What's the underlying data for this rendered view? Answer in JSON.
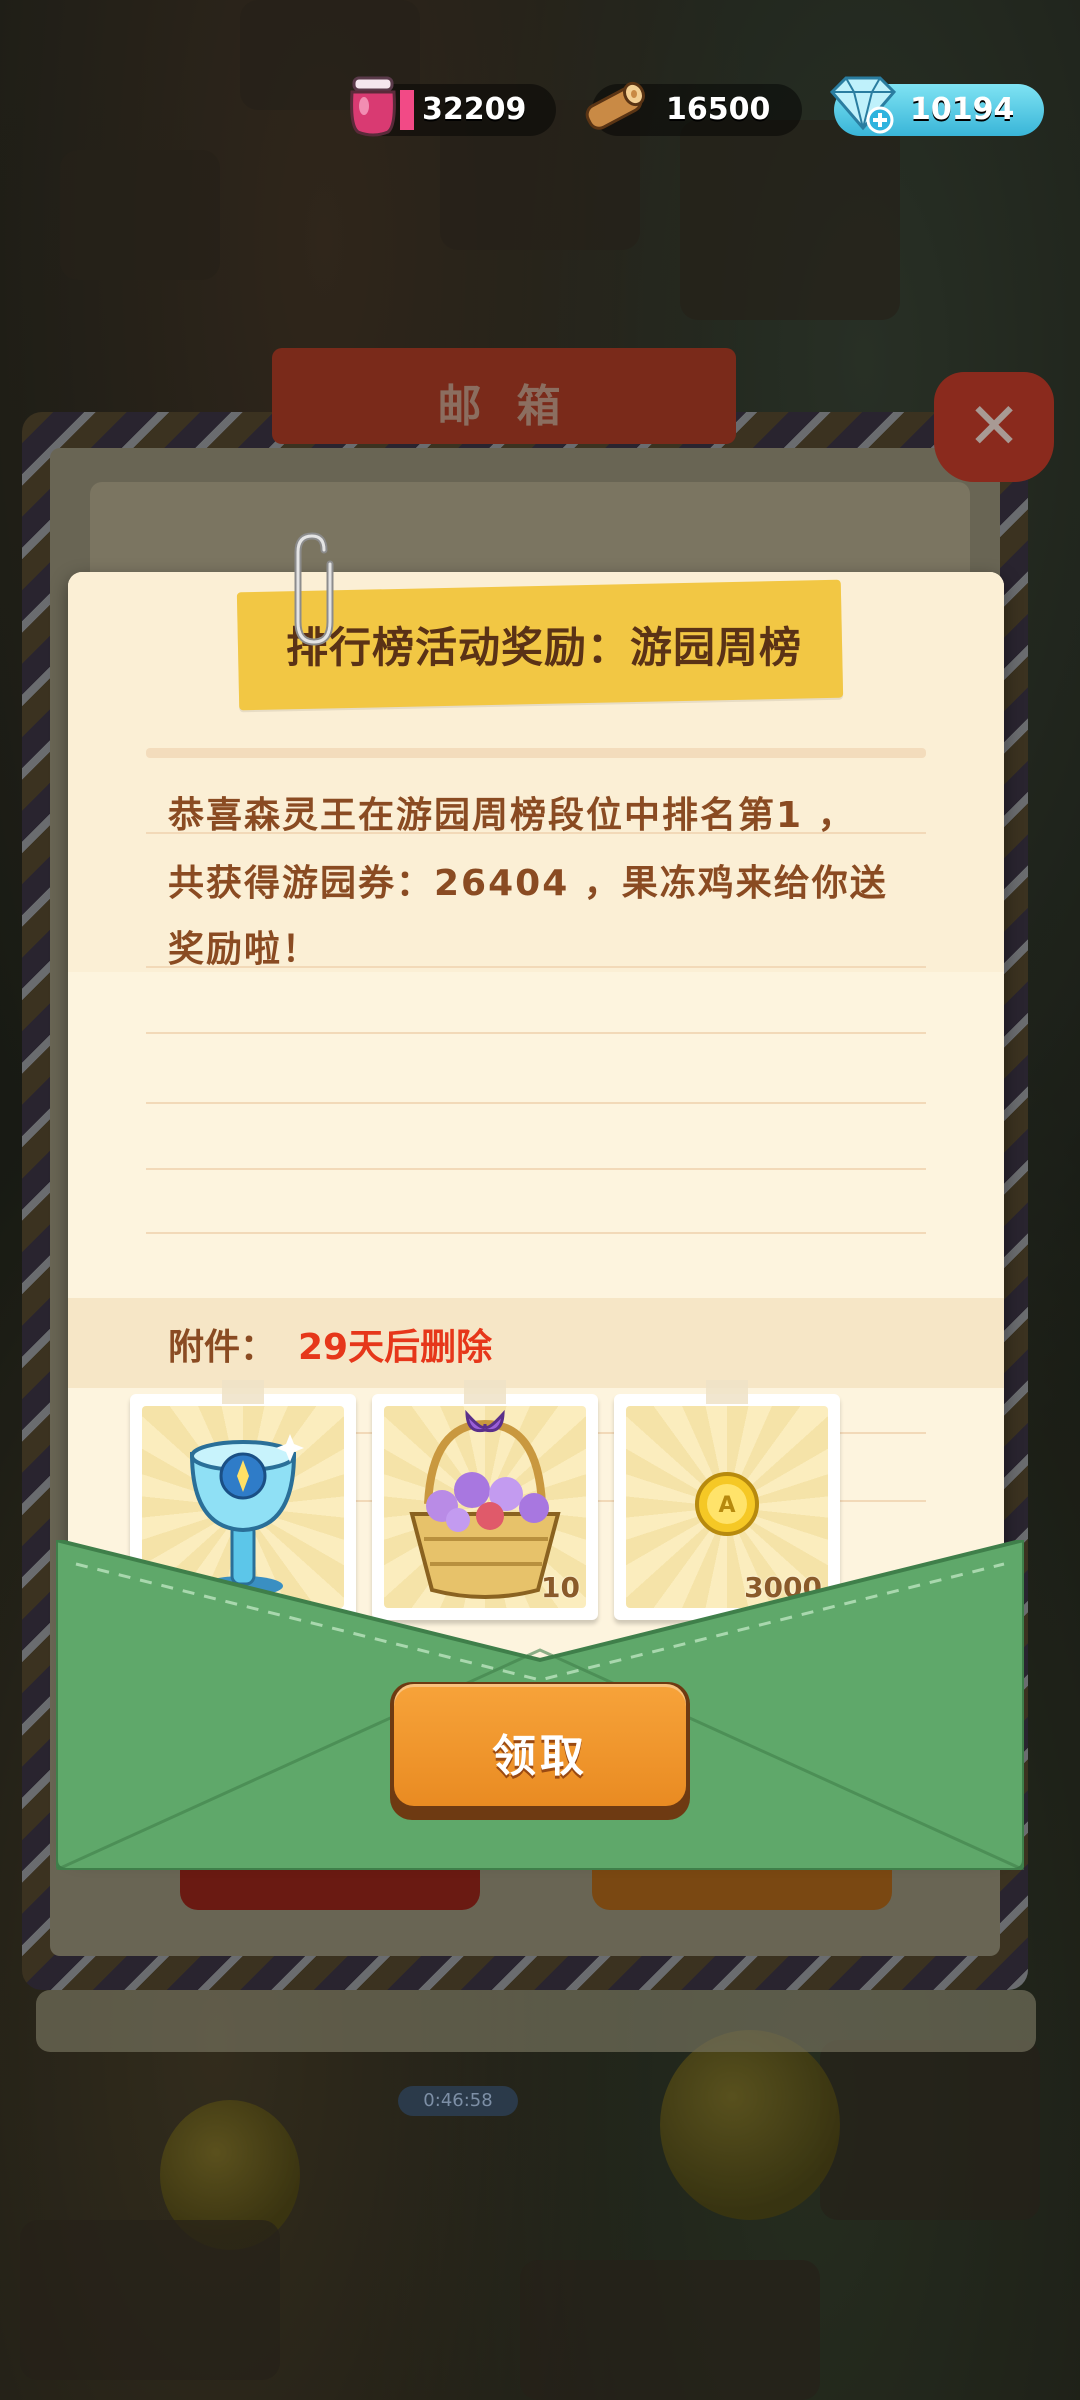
{
  "currency": {
    "jam": "32209",
    "wood": "16500",
    "gems": "10194"
  },
  "mailbox": {
    "title": "邮 箱",
    "close": "✕",
    "timer": "0:46:58"
  },
  "letter": {
    "title": "排行榜活动奖励：游园周榜",
    "body_lines": [
      "恭喜森灵王在游园周榜段位中排名第1 ，",
      "共获得游园券：26404 ，果冻鸡来给你送",
      "奖励啦！"
    ],
    "attachment_label": "附件：",
    "attachment_expire": "29天后删除",
    "rewards": [
      {
        "name": "trophy-cup",
        "qty": ""
      },
      {
        "name": "flower-basket",
        "qty": "10"
      },
      {
        "name": "gold-coin",
        "qty": "3000"
      }
    ],
    "claim_label": "领取"
  },
  "colors": {
    "letter_bg": "#fdf4de",
    "text_brown": "#8a4b22",
    "expire_red": "#e6371a",
    "tape_yellow": "#f2c744",
    "envelope_green": "#5fa86a",
    "button_orange": "#f09a2e"
  }
}
